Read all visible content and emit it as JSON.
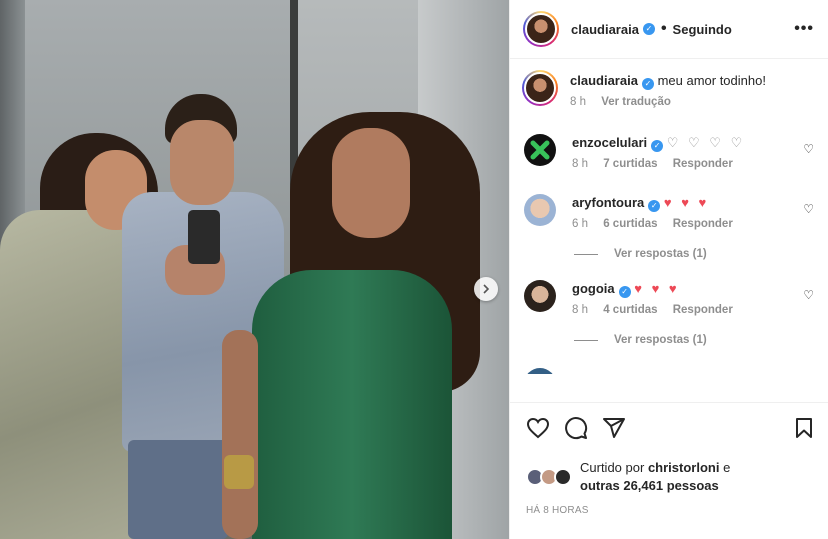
{
  "post": {
    "author": "claudiaraia",
    "separator": "•",
    "follow_label": "Seguindo",
    "more_glyph": "•••",
    "caption_user": "claudiaraia",
    "caption_text": "meu amor todinho!",
    "caption_time": "8 h",
    "translate_label": "Ver tradução",
    "carousel_next_glyph": "›"
  },
  "comments": [
    {
      "user": "enzocelulari",
      "text": "♡ ♡ ♡ ♡",
      "time": "8 h",
      "likes": "7 curtidas",
      "reply": "Responder",
      "heart": "♡"
    },
    {
      "user": "aryfontoura",
      "text": "♥ ♥ ♥",
      "time": "6 h",
      "likes": "6 curtidas",
      "reply": "Responder",
      "heart": "♡",
      "view_replies": "Ver respostas (1)"
    },
    {
      "user": "gogoia",
      "text": "♥ ♥ ♥",
      "time": "8 h",
      "likes": "4 curtidas",
      "reply": "Responder",
      "heart": "♡",
      "view_replies": "Ver respostas (1)"
    }
  ],
  "likes": {
    "prefix": "Curtido por",
    "user": "christorloni",
    "conj": "e",
    "others": "outras 26,461 pessoas"
  },
  "timestamp": "HÁ 8 HORAS",
  "colors": {
    "verified": "#3897f0",
    "heart_red": "#ed4956",
    "muted": "#8e8e8e"
  }
}
